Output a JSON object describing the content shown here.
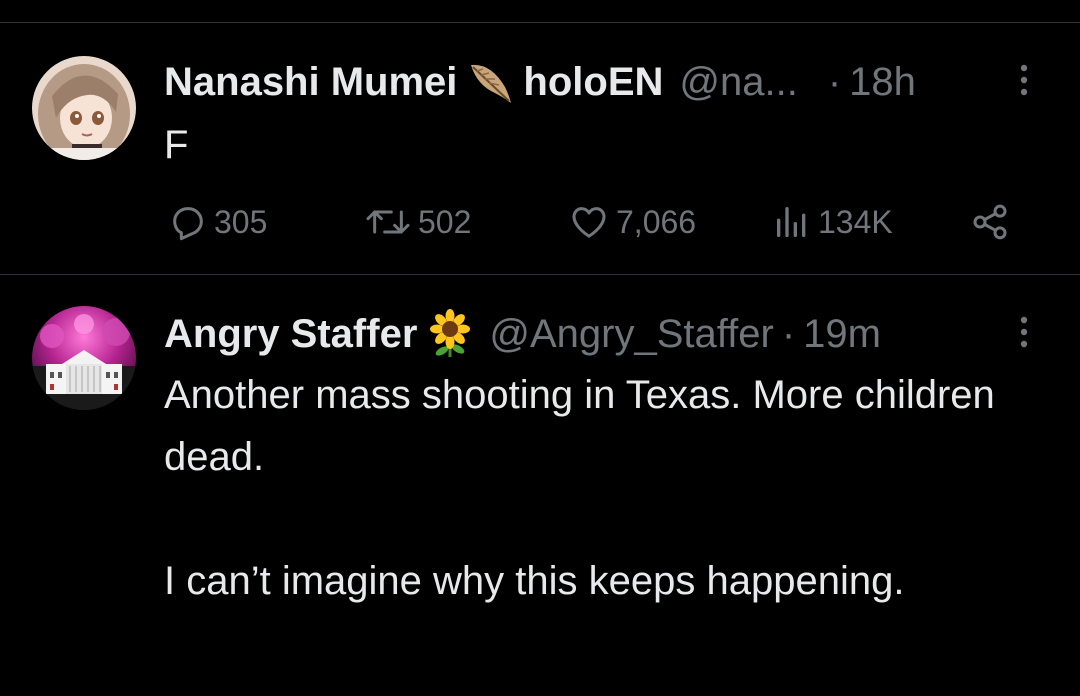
{
  "tweets": [
    {
      "display_name": "Nanashi Mumei",
      "badge_icon": "feather-icon",
      "org": "holoEN",
      "handle": "@na...",
      "separator": "·",
      "time": "18h",
      "text": "F",
      "stats": {
        "replies": "305",
        "retweets": "502",
        "likes": "7,066",
        "views": "134K"
      }
    },
    {
      "display_name": "Angry Staffer",
      "badge_icon": "sunflower-icon",
      "handle": "@Angry_Staffer",
      "separator": "·",
      "time": "19m",
      "text": "Another mass shooting in Texas. More children dead.\n\nI can’t imagine why this keeps happening."
    }
  ],
  "colors": {
    "background": "#000000",
    "primary_text": "#e7e9ea",
    "secondary_text": "#71767b",
    "divider": "#2f3336"
  }
}
